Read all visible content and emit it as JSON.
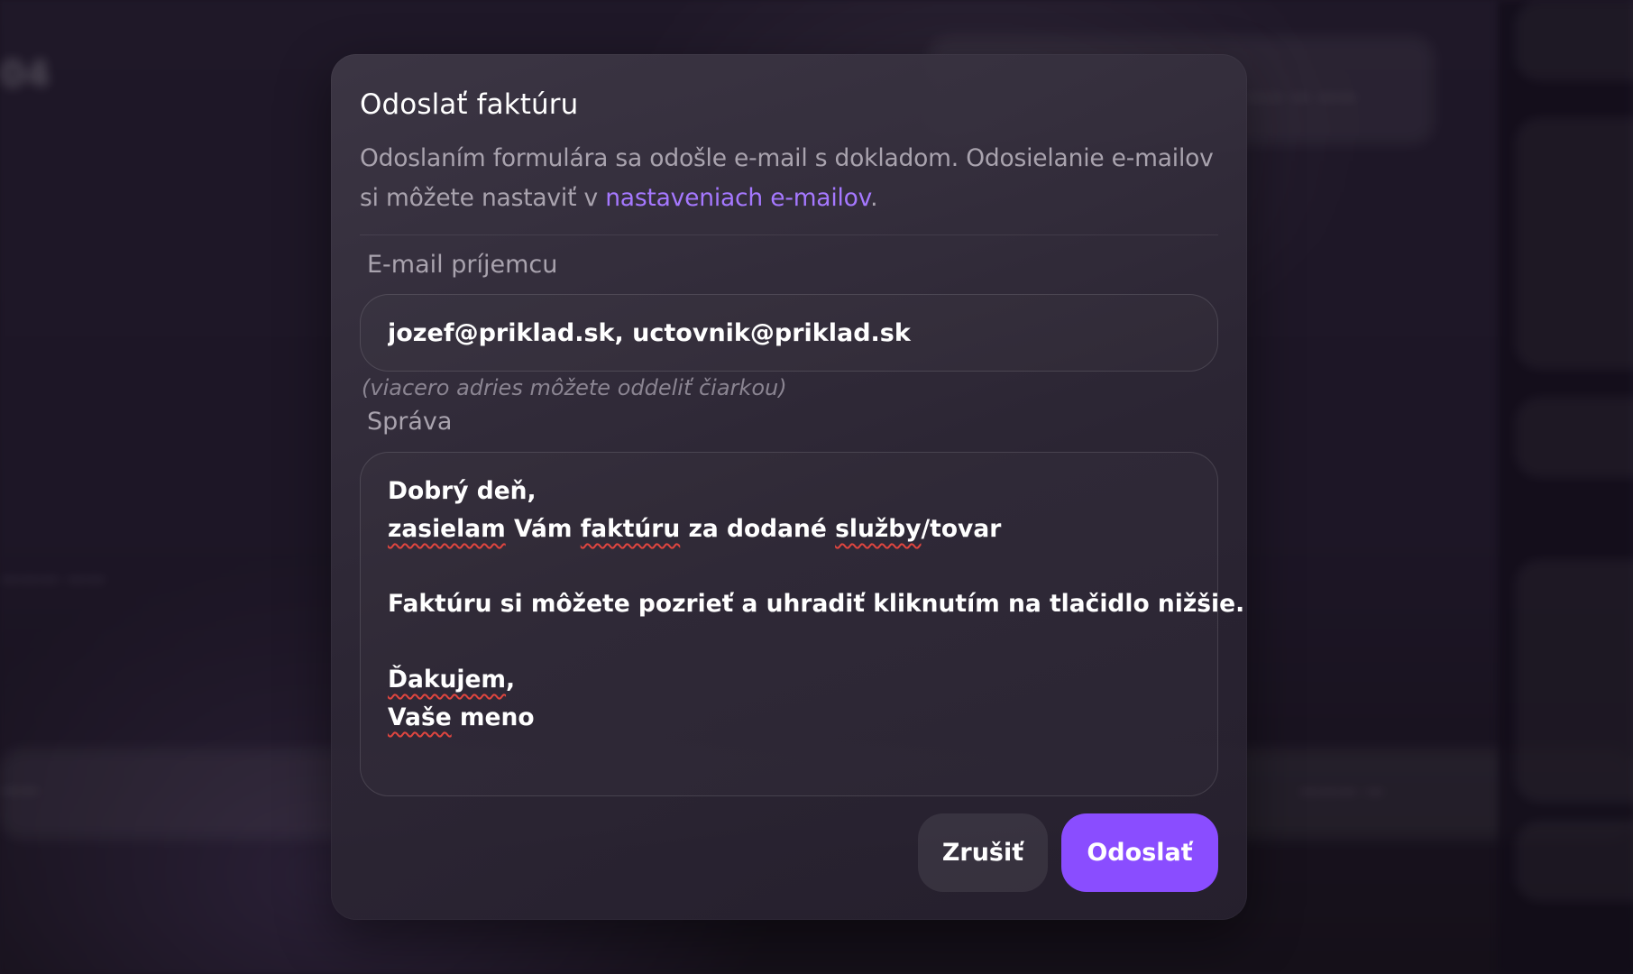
{
  "modal": {
    "title": "Odoslať faktúru",
    "description_before_link": "Odoslaním formulára sa odošle e-mail s dokladom. Odosielanie e-mailov si môžete nastaviť v ",
    "description_link": "nastaveniach e-mailov",
    "description_after_link": ".",
    "email_label": "E-mail príjemcu",
    "email_value": "jozef@priklad.sk, uctovnik@priklad.sk",
    "email_hint": "(viacero adries môžete oddeliť čiarkou)",
    "message_label": "Správa",
    "message_lines": [
      "Dobrý deň,",
      "zasielam Vám faktúru za dodané služby/tovar",
      "",
      "Faktúru si môžete pozrieť a uhradiť kliknutím na tlačidlo nižšie.",
      "",
      "Ďakujem,",
      "Vaše meno"
    ],
    "cancel_label": "Zrušiť",
    "send_label": "Odoslať"
  },
  "colors": {
    "accent": "#8a4dff",
    "link": "#a578ff",
    "modal_bg": "#2e2836",
    "page_bg": "#1b1523"
  }
}
